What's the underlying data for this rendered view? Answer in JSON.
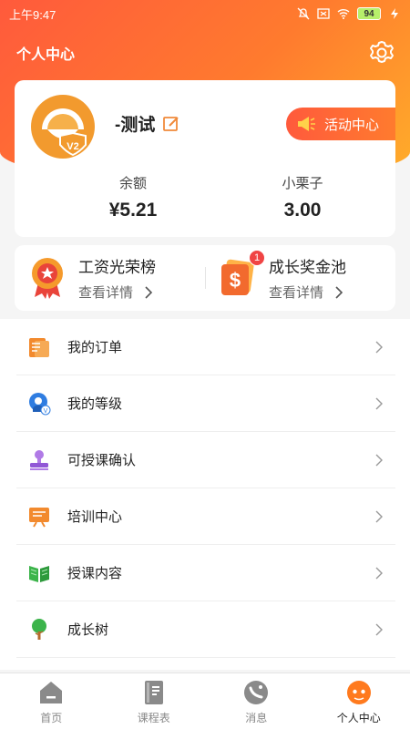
{
  "status_bar": {
    "time": "上午9:47",
    "battery": "94",
    "icons": [
      "mute-icon",
      "sim-blocked-icon",
      "wifi-icon",
      "battery-icon",
      "charging-icon"
    ]
  },
  "header": {
    "title": "个人中心",
    "settings_icon": "gear-icon"
  },
  "profile": {
    "username": "-测试",
    "level_badge": "V2",
    "activity_button": "活动中心",
    "balance": {
      "label": "余额",
      "value": "¥5.21"
    },
    "chestnut": {
      "label": "小栗子",
      "value": "3.00"
    }
  },
  "promos": [
    {
      "title": "工资光荣榜",
      "sub": "查看详情",
      "icon": "medal-icon"
    },
    {
      "title": "成长奖金池",
      "sub": "查看详情",
      "icon": "dollar-card-icon",
      "badge": "1"
    }
  ],
  "menu": {
    "items": [
      {
        "label": "我的订单",
        "icon": "order-icon"
      },
      {
        "label": "我的等级",
        "icon": "level-icon"
      },
      {
        "label": "可授课确认",
        "icon": "stamp-icon"
      },
      {
        "label": "培训中心",
        "icon": "training-icon"
      },
      {
        "label": "授课内容",
        "icon": "book-icon"
      },
      {
        "label": "成长树",
        "icon": "tree-icon"
      }
    ]
  },
  "tabs": [
    {
      "label": "首页",
      "icon": "home-icon"
    },
    {
      "label": "课程表",
      "icon": "schedule-icon"
    },
    {
      "label": "消息",
      "icon": "message-icon"
    },
    {
      "label": "个人中心",
      "icon": "profile-icon",
      "active": true
    }
  ],
  "colors": {
    "accent": "#ff6a33",
    "gradient_start": "#ff5a3c",
    "gradient_end": "#ffae2a"
  }
}
